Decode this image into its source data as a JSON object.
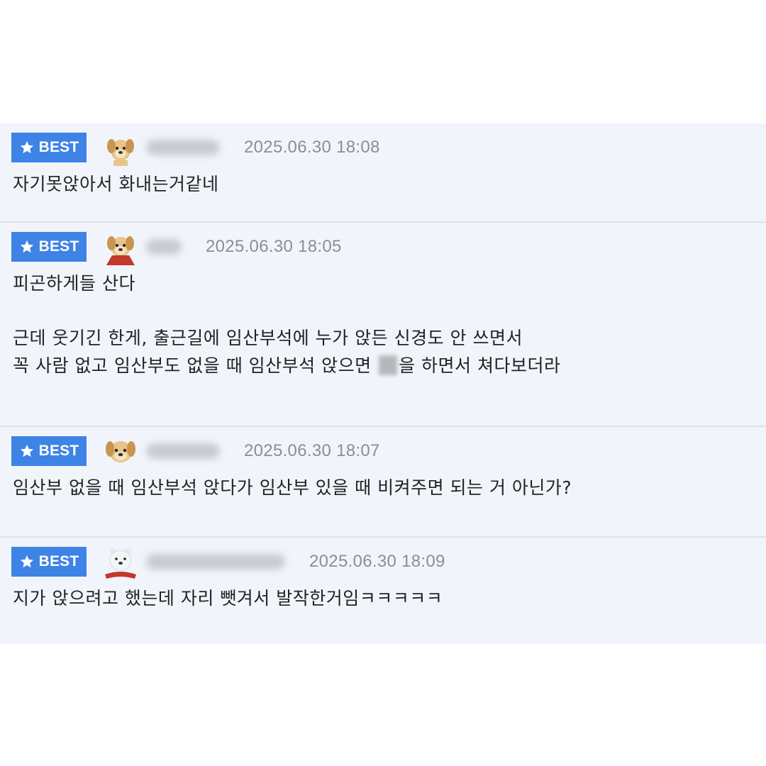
{
  "badge_label": "BEST",
  "colors": {
    "badge": "#3e83e6",
    "row_bg": "#f1f5fb",
    "divider": "#dde2ea",
    "date": "#8b8e93"
  },
  "comments": [
    {
      "avatar": "puppy-icon",
      "date": "2025.06.30 18:08",
      "lines": [
        "자기못앉아서 화내는거같네"
      ]
    },
    {
      "avatar": "puppy-scarf-icon",
      "date": "2025.06.30 18:05",
      "lines": [
        "피곤하게들 산다",
        "",
        "근데 웃기긴 한게, 출근길에 임산부석에 누가 앉든 신경도 안 쓰면서",
        "꼭 사람 없고 임산부도 없을 때 임산부석 앉으면 "
      ],
      "line4_tail": "을 하면서 쳐다보더라"
    },
    {
      "avatar": "puppy-face-icon",
      "date": "2025.06.30 18:07",
      "lines": [
        "임산부 없을 때 임산부석 앉다가 임산부 있을 때 비켜주면 되는 거 아닌가?"
      ]
    },
    {
      "avatar": "polar-bear-icon",
      "date": "2025.06.30 18:09",
      "lines": [
        "지가 앉으려고 했는데 자리 뺏겨서 발작한거임ㅋㅋㅋㅋㅋ"
      ]
    }
  ]
}
